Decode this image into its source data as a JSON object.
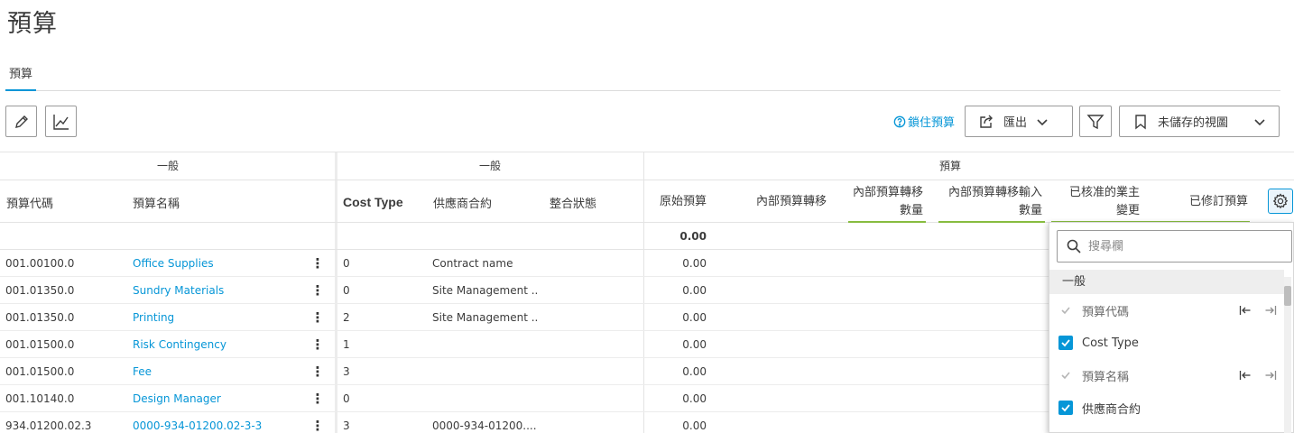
{
  "page": {
    "title": "預算"
  },
  "tabs": [
    {
      "label": "預算"
    }
  ],
  "toolbar": {
    "lock_label": "鎖住預算",
    "export_label": "匯出",
    "view_label": "未儲存的視圖"
  },
  "grid": {
    "groups": [
      "一般",
      "一般",
      "預算"
    ],
    "headers": {
      "code": "預算代碼",
      "name": "預算名稱",
      "cost_type": "Cost Type",
      "contract": "供應商合約",
      "status": "整合狀態",
      "original": "原始預算",
      "internal_transfer": "內部預算轉移",
      "internal_transfer_qty_1": "內部預算轉移",
      "internal_transfer_qty_2": "數量",
      "internal_transfer_in_qty_1": "內部預算轉移輸入",
      "internal_transfer_in_qty_2": "數量",
      "approved_owner_1": "已核准的業主",
      "approved_owner_2": "變更",
      "revised": "已修訂預算"
    },
    "total_original": "0.00",
    "rows": [
      {
        "code": "001.00100.0",
        "name": "Office Supplies",
        "cost_type": "0",
        "contract": "Contract name",
        "original": "0.00"
      },
      {
        "code": "001.01350.0",
        "name": "Sundry Materials",
        "cost_type": "0",
        "contract": "Site Management ...",
        "original": "0.00"
      },
      {
        "code": "001.01350.0",
        "name": "Printing",
        "cost_type": "2",
        "contract": "Site Management ...",
        "original": "0.00"
      },
      {
        "code": "001.01500.0",
        "name": "Risk Contingency",
        "cost_type": "1",
        "contract": "",
        "original": "0.00"
      },
      {
        "code": "001.01500.0",
        "name": "Fee",
        "cost_type": "3",
        "contract": "",
        "original": "0.00"
      },
      {
        "code": "001.10140.0",
        "name": "Design Manager",
        "cost_type": "0",
        "contract": "",
        "original": "0.00"
      },
      {
        "code": "934.01200.02.3",
        "name": "0000-934-01200.02-3-3",
        "cost_type": "3",
        "contract": "0000-934-01200....",
        "original": "0.00"
      }
    ]
  },
  "column_panel": {
    "search_placeholder": "搜尋欄",
    "group": "一般",
    "items": [
      {
        "label": "預算代碼",
        "state": "disabled"
      },
      {
        "label": "Cost Type",
        "state": "checked"
      },
      {
        "label": "預算名稱",
        "state": "disabled"
      },
      {
        "label": "供應商合約",
        "state": "checked"
      }
    ]
  }
}
